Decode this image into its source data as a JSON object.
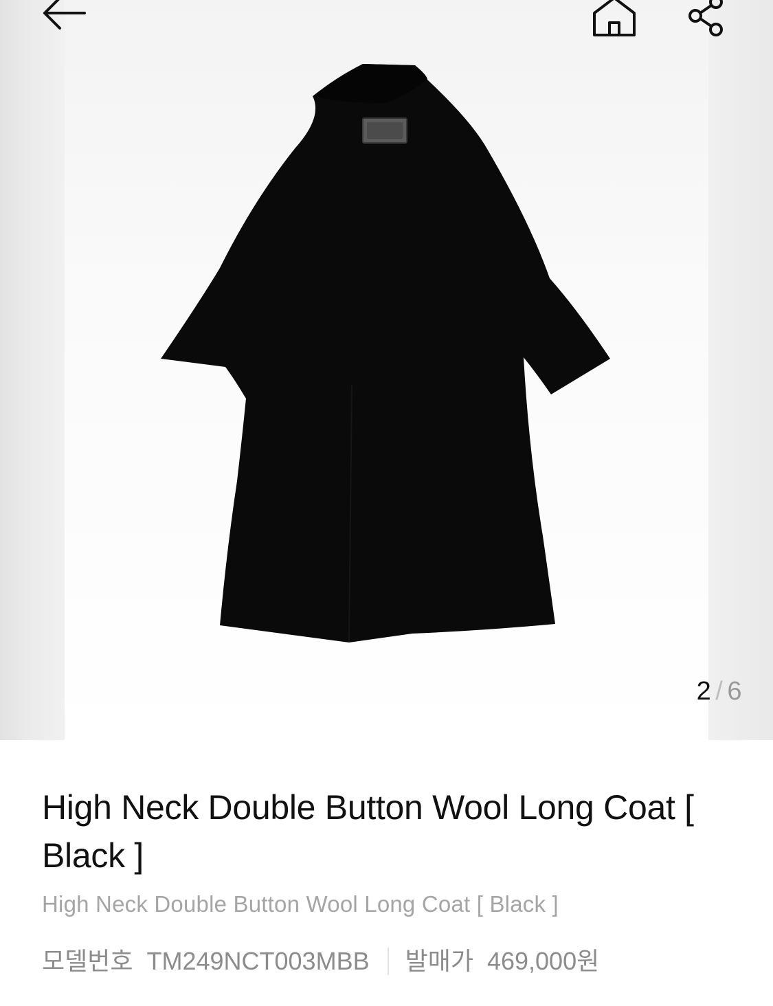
{
  "gallery": {
    "current": "2",
    "separator": "/",
    "total": "6",
    "image_alt": "Black wool long coat, back view"
  },
  "nav": {
    "back_icon": "arrow-left-icon",
    "home_icon": "home-icon",
    "share_icon": "share-icon"
  },
  "product": {
    "title": "High Neck Double Button Wool Long Coat [ Black ]",
    "subtitle": "High Neck Double Button Wool Long Coat [ Black ]",
    "model_label": "모델번호",
    "model_value": "TM249NCT003MBB",
    "price_label": "발매가",
    "price_value": "469,000원"
  },
  "colors": {
    "coat": "#0a0a0a",
    "title_text": "#111111",
    "muted_text": "#a5a5a5"
  }
}
